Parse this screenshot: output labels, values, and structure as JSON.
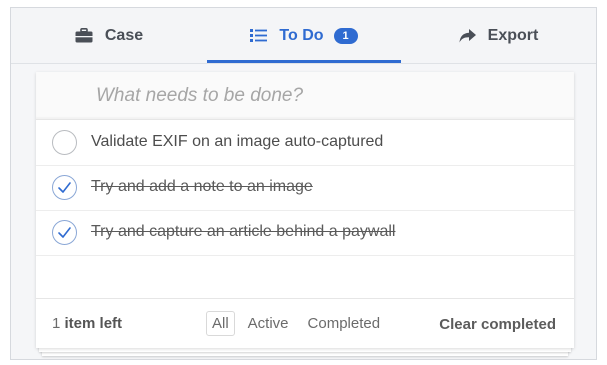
{
  "tabs": {
    "case": {
      "label": "Case",
      "icon": "briefcase-icon"
    },
    "todo": {
      "label": "To Do",
      "icon": "list-icon",
      "badge": "1"
    },
    "export": {
      "label": "Export",
      "icon": "share-arrow-icon"
    }
  },
  "todo": {
    "placeholder": "What needs to be done?",
    "items": [
      {
        "text": "Validate EXIF on an image auto-captured",
        "completed": false
      },
      {
        "text": "Try and add a note to an image",
        "completed": true
      },
      {
        "text": "Try and capture an article behind a paywall",
        "completed": true
      }
    ]
  },
  "footer": {
    "count_number": "1",
    "count_suffix": "item left",
    "filters": [
      "All",
      "Active",
      "Completed"
    ],
    "selected_filter": "All",
    "clear_label": "Clear completed"
  },
  "colors": {
    "accent": "#2f6bd1",
    "tab_text": "#4a4f57",
    "background": "#f5f6f8"
  }
}
